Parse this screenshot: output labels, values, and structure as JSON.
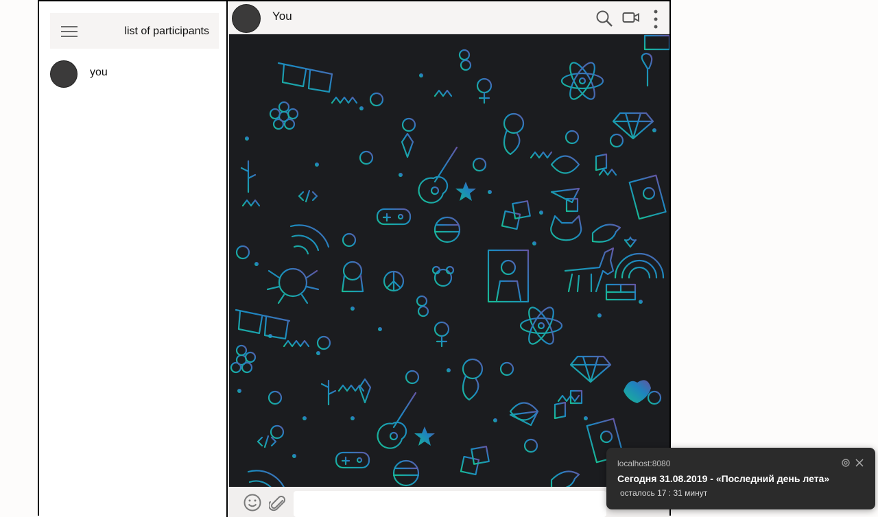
{
  "sidebar": {
    "title": "list of participants",
    "participants": [
      {
        "name": "you"
      }
    ]
  },
  "chat": {
    "title": "You",
    "input_placeholder": ""
  },
  "icons": {
    "menu": "hamburger-menu-icon",
    "search": "search-icon",
    "video": "video-camera-icon",
    "more": "more-vertical-icon",
    "emoji": "emoji-icon",
    "attach": "paperclip-icon",
    "settings": "gear-icon",
    "close": "close-icon"
  },
  "notification": {
    "origin": "localhost:8080",
    "title": "Сегодня 31.08.2019 - «Последний день лета»",
    "body": "осталось 17 : 31 минут"
  },
  "colors": {
    "doodle_gradient_top": "#6b5bb0",
    "doodle_gradient_mid": "#1f8fd0",
    "doodle_gradient_bottom": "#18c9a0",
    "chat_background": "#1b1c1f"
  }
}
